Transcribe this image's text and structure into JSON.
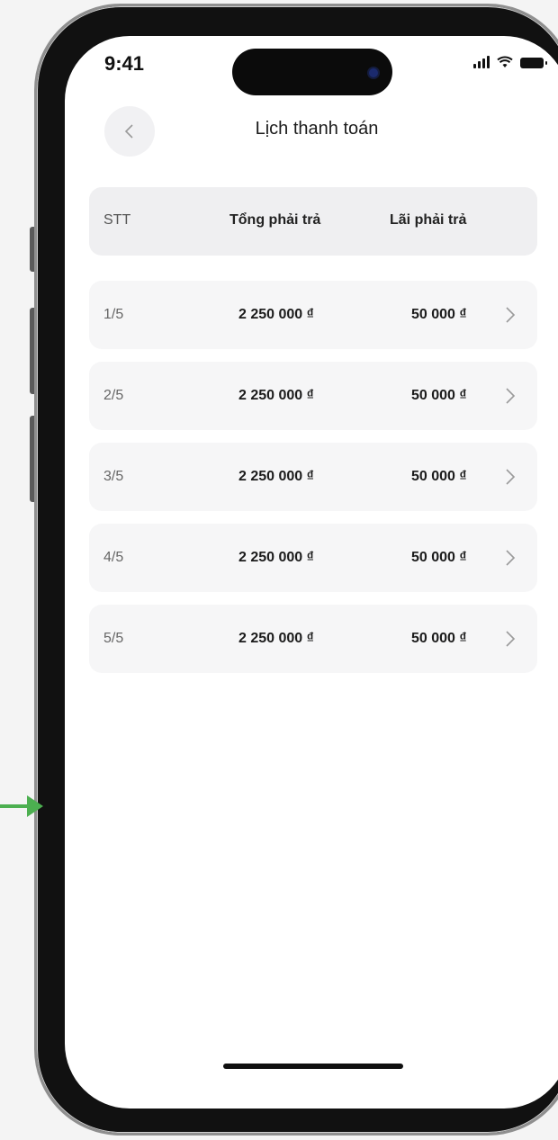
{
  "status_bar": {
    "time": "9:41"
  },
  "header": {
    "title": "Lịch thanh toán"
  },
  "table": {
    "columns": {
      "stt": "STT",
      "total": "Tổng phải trả",
      "interest": "Lãi phải trả"
    },
    "rows": [
      {
        "stt": "1/5",
        "total": "2 250 000 ₫",
        "interest": "50 000 ₫"
      },
      {
        "stt": "2/5",
        "total": "2 250 000 ₫",
        "interest": "50 000 ₫"
      },
      {
        "stt": "3/5",
        "total": "2 250 000 ₫",
        "interest": "50 000 ₫"
      },
      {
        "stt": "4/5",
        "total": "2 250 000 ₫",
        "interest": "50 000 ₫"
      },
      {
        "stt": "5/5",
        "total": "2 250 000 ₫",
        "interest": "50 000 ₫"
      }
    ]
  },
  "icons": {
    "back": "chevron-left-icon",
    "row_chevron": "chevron-right-icon",
    "signal": "signal-icon",
    "wifi": "wifi-icon",
    "battery": "battery-icon",
    "annotation_arrow": "arrow-right-icon"
  },
  "colors": {
    "annotation_arrow": "#4caf50",
    "row_background": "#f6f6f7",
    "header_background": "#efeff1"
  }
}
